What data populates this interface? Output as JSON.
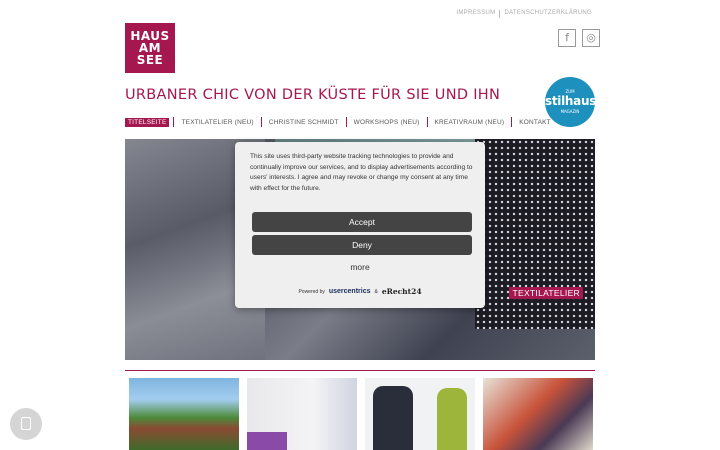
{
  "top_links": [
    "IMPRESSUM",
    "DATENSCHUTZERKLÄRUNG"
  ],
  "logo": {
    "lines": [
      "HAUS",
      "AM",
      "SEE"
    ]
  },
  "social": {
    "facebook": "f",
    "instagram": "◎"
  },
  "badge": {
    "top": "ZUM",
    "main": "stilhaus",
    "bottom": "MAGAZIN"
  },
  "headline": "URBANER CHIC VON DER KÜSTE FÜR SIE UND IHN",
  "nav": [
    "TITELSEITE",
    "TEXTILATELIER (NEU)",
    "CHRISTINE SCHMIDT",
    "WORKSHOPS (NEU)",
    "KREATIVRAUM (NEU)",
    "KONTAKT"
  ],
  "hero": {
    "label": "TEXTILATELIER"
  },
  "consent": {
    "message": "This site uses third-party website tracking technologies to provide and continually improve our services, and to display advertisements according to users' interests. I agree and may revoke or change my consent at any time with effect for the future.",
    "accept": "Accept",
    "deny": "Deny",
    "more": "more",
    "powered_by": "Powered by",
    "usercentrics": "usercentrics",
    "amp": "&",
    "erecht": "eRecht24"
  },
  "colors": {
    "brand": "#a5174f",
    "badge": "#1e90bd",
    "button": "#444444"
  }
}
